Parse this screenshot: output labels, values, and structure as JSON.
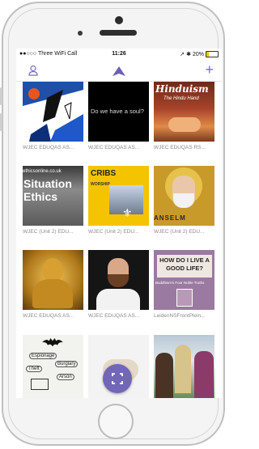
{
  "status_bar": {
    "carrier": "●●○○○ Three WiFi Call",
    "time": "11:26",
    "battery": "20%",
    "battery_level": 0.2
  },
  "nav_bar": {
    "user_icon": "person-icon",
    "logo_icon": "app-logo-icon",
    "add_label": "+"
  },
  "tiles": [
    {
      "caption": "WJEC EDUQAS AS...",
      "text": ""
    },
    {
      "caption": "WJEC EDUQAS AS...",
      "text": "Do we have a soul?"
    },
    {
      "caption": "WJEC EDUQAS RS...",
      "text": "Hinduism",
      "subtext": "The Hindu Hand"
    },
    {
      "caption": "WJEC (Unit 2) EDU...",
      "text": "Situation Ethics",
      "subtext": "ethicsonline.co.uk"
    },
    {
      "caption": "WJEC (Unit 2) EDU...",
      "text": "CRIBS",
      "subtext": "WORSHIP"
    },
    {
      "caption": "WJEC (Unit 2) EDU...",
      "text": "ANSELM"
    },
    {
      "caption": "WJEC EDUQAS AS...",
      "text": ""
    },
    {
      "caption": "WJEC EDUQAS AS...",
      "text": ""
    },
    {
      "caption": "LeidenNSFrontPlein...",
      "text": "HOW DO I LIVE A GOOD LIFE?",
      "subtext": "Buddhism's Four Noble Truths"
    },
    {
      "caption": "",
      "text": "",
      "doodle": [
        "Espionage",
        "Theft",
        "Burglary",
        "Arson"
      ]
    },
    {
      "caption": "",
      "text": ""
    },
    {
      "caption": "",
      "text": ""
    }
  ],
  "fab": {
    "icon": "expand-icon"
  }
}
